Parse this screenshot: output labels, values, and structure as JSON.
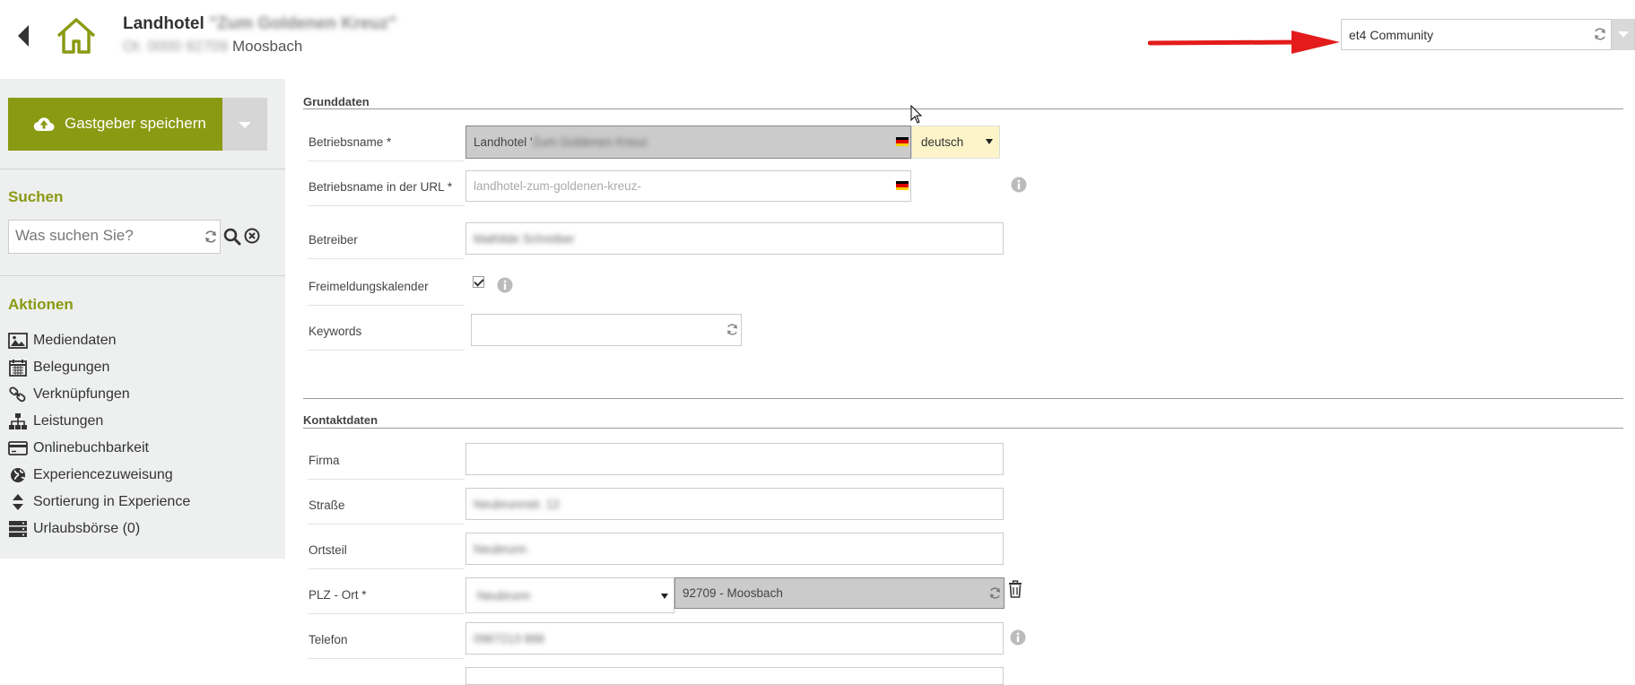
{
  "header": {
    "title_prefix": "Landhotel",
    "title_blurred": "\"Zum Goldenen Kreuz\"",
    "sub_blurred": "Ot. 0000 92709",
    "sub_city": "Moosbach"
  },
  "community_select": {
    "value": "et4 Community"
  },
  "sidebar": {
    "save_label": "Gastgeber speichern",
    "search_heading": "Suchen",
    "search_placeholder": "Was suchen Sie?",
    "actions_heading": "Aktionen",
    "actions": [
      {
        "label": "Mediendaten",
        "icon": "image-icon"
      },
      {
        "label": "Belegungen",
        "icon": "calendar-icon"
      },
      {
        "label": "Verknüpfungen",
        "icon": "link-icon"
      },
      {
        "label": "Leistungen",
        "icon": "sitemap-icon"
      },
      {
        "label": "Onlinebuchbarkeit",
        "icon": "credit-card-icon"
      },
      {
        "label": "Experiencezuweisung",
        "icon": "globe-icon"
      },
      {
        "label": "Sortierung in Experience",
        "icon": "sort-icon"
      },
      {
        "label": "Urlaubsbörse (0)",
        "icon": "server-icon"
      }
    ]
  },
  "grunddaten": {
    "title": "Grunddaten",
    "betriebsname_label": "Betriebsname *",
    "betriebsname_value": "Landhotel '",
    "betriebsname_blurred": "Zum Goldenen Kreuz",
    "language": "deutsch",
    "url_label": "Betriebsname in der URL *",
    "url_placeholder": "landhotel-zum-goldenen-kreuz-",
    "betreiber_label": "Betreiber",
    "betreiber_blurred": "Mathilde Schreiber",
    "freimeldung_label": "Freimeldungskalender",
    "keywords_label": "Keywords"
  },
  "kontaktdaten": {
    "title": "Kontaktdaten",
    "firma_label": "Firma",
    "strasse_label": "Straße",
    "strasse_blurred": "Neubrunnstr. 12",
    "ortsteil_label": "Ortsteil",
    "ortsteil_blurred": "Neubrunn",
    "plz_label": "PLZ - Ort *",
    "plz_select_blurred": "Neubrunn",
    "plz_value": "92709 - Moosbach",
    "telefon_label": "Telefon",
    "telefon_blurred": "0967213 888"
  },
  "colors": {
    "accent": "#8a9a12",
    "sidebar_bg": "#eeefef",
    "lang_bg": "#fdf5c9",
    "arrow": "#e31b1b"
  }
}
